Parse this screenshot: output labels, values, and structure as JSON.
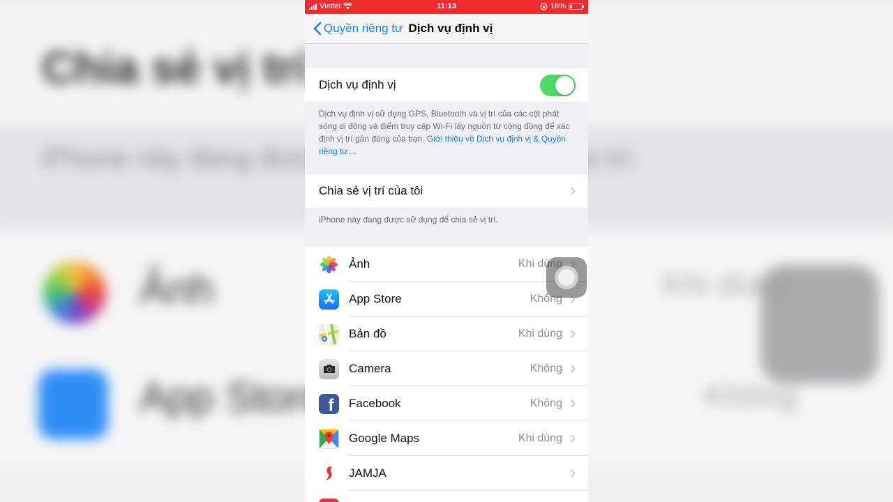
{
  "status_bar": {
    "carrier": "Viettel",
    "time": "11:13",
    "battery": "16%",
    "battery_level": 0.16
  },
  "nav": {
    "back_label": "Quyền riêng tư",
    "title": "Dịch vụ định vị"
  },
  "location_services": {
    "label": "Dịch vụ định vị",
    "enabled": true,
    "description": "Dịch vụ định vị sử dụng GPS, Bluetooth và vị trí của các cột phát sóng di động và điểm truy cập Wi-Fi lấy nguồn từ cộng đồng để xác định vị trí gần đúng của bạn. ",
    "description_link": "Giới thiệu về Dịch vụ định vị & Quyền riêng tư…"
  },
  "share_location": {
    "label": "Chia sẻ vị trí của tôi",
    "footnote": "iPhone này đang được sử dụng để chia sẻ vị trí."
  },
  "apps": [
    {
      "name": "Ảnh",
      "value": "Khi dùng",
      "icon": "photos-icon"
    },
    {
      "name": "App Store",
      "value": "Không",
      "icon": "app-store-icon"
    },
    {
      "name": "Bản đồ",
      "value": "Khi dùng",
      "icon": "maps-icon"
    },
    {
      "name": "Camera",
      "value": "Không",
      "icon": "camera-icon"
    },
    {
      "name": "Facebook",
      "value": "Không",
      "icon": "facebook-icon"
    },
    {
      "name": "Google Maps",
      "value": "Khi dùng",
      "icon": "google-maps-icon"
    },
    {
      "name": "JAMJA",
      "value": "",
      "icon": "jamja-icon"
    }
  ],
  "colors": {
    "status_bar": "#ee2b2f",
    "accent": "#157efb",
    "toggle_on": "#4cd964"
  },
  "backdrop": {
    "title": "Chia sẻ vị trí của",
    "subtitle": "iPhone này đang được sử dụng để chia sẻ vị trí.",
    "app1": "Ảnh",
    "app2": "App Store",
    "right1": "Khi dùng",
    "right2": "Không"
  }
}
